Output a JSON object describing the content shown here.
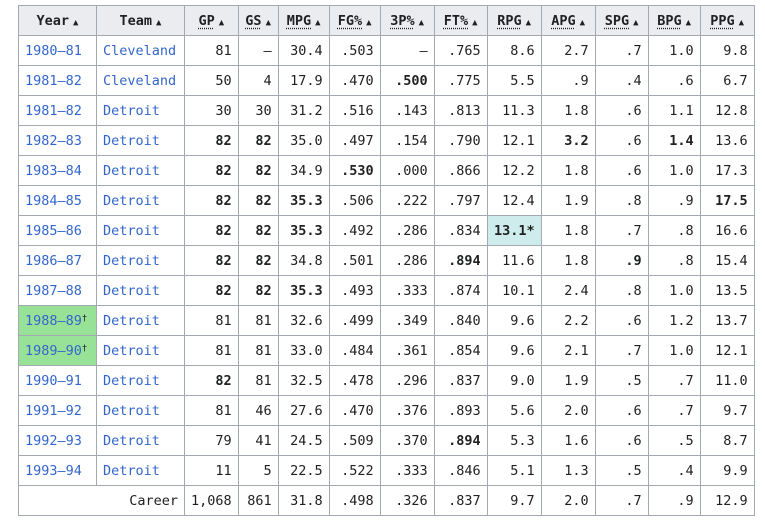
{
  "columns": [
    "Year",
    "Team",
    "GP",
    "GS",
    "MPG",
    "FG%",
    "3P%",
    "FT%",
    "RPG",
    "APG",
    "SPG",
    "BPG",
    "PPG"
  ],
  "rows": [
    {
      "year": "1980–81",
      "team": "Cleveland",
      "gp": "81",
      "gs": "–",
      "mpg": "30.4",
      "fg": ".503",
      "tp": "–",
      "ft": ".765",
      "rpg": "8.6",
      "apg": "2.7",
      "spg": ".7",
      "bpg": "1.0",
      "ppg": "9.8"
    },
    {
      "year": "1981–82",
      "team": "Cleveland",
      "gp": "50",
      "gs": "4",
      "mpg": "17.9",
      "fg": ".470",
      "tp": ".500",
      "ft": ".775",
      "rpg": "5.5",
      "apg": ".9",
      "spg": ".4",
      "bpg": ".6",
      "ppg": "6.7"
    },
    {
      "year": "1981–82",
      "team": "Detroit",
      "gp": "30",
      "gs": "30",
      "mpg": "31.2",
      "fg": ".516",
      "tp": ".143",
      "ft": ".813",
      "rpg": "11.3",
      "apg": "1.8",
      "spg": ".6",
      "bpg": "1.1",
      "ppg": "12.8"
    },
    {
      "year": "1982–83",
      "team": "Detroit",
      "gp": "82",
      "gs": "82",
      "mpg": "35.0",
      "fg": ".497",
      "tp": ".154",
      "ft": ".790",
      "rpg": "12.1",
      "apg": "3.2",
      "spg": ".6",
      "bpg": "1.4",
      "ppg": "13.6"
    },
    {
      "year": "1983–84",
      "team": "Detroit",
      "gp": "82",
      "gs": "82",
      "mpg": "34.9",
      "fg": ".530",
      "tp": ".000",
      "ft": ".866",
      "rpg": "12.2",
      "apg": "1.8",
      "spg": ".6",
      "bpg": "1.0",
      "ppg": "17.3"
    },
    {
      "year": "1984–85",
      "team": "Detroit",
      "gp": "82",
      "gs": "82",
      "mpg": "35.3",
      "fg": ".506",
      "tp": ".222",
      "ft": ".797",
      "rpg": "12.4",
      "apg": "1.9",
      "spg": ".8",
      "bpg": ".9",
      "ppg": "17.5"
    },
    {
      "year": "1985–86",
      "team": "Detroit",
      "gp": "82",
      "gs": "82",
      "mpg": "35.3",
      "fg": ".492",
      "tp": ".286",
      "ft": ".834",
      "rpg": "13.1*",
      "apg": "1.8",
      "spg": ".7",
      "bpg": ".8",
      "ppg": "16.6"
    },
    {
      "year": "1986–87",
      "team": "Detroit",
      "gp": "82",
      "gs": "82",
      "mpg": "34.8",
      "fg": ".501",
      "tp": ".286",
      "ft": ".894",
      "rpg": "11.6",
      "apg": "1.8",
      "spg": ".9",
      "bpg": ".8",
      "ppg": "15.4"
    },
    {
      "year": "1987–88",
      "team": "Detroit",
      "gp": "82",
      "gs": "82",
      "mpg": "35.3",
      "fg": ".493",
      "tp": ".333",
      "ft": ".874",
      "rpg": "10.1",
      "apg": "2.4",
      "spg": ".8",
      "bpg": "1.0",
      "ppg": "13.5"
    },
    {
      "year": "1988–89",
      "year_mark": "†",
      "team": "Detroit",
      "gp": "81",
      "gs": "81",
      "mpg": "32.6",
      "fg": ".499",
      "tp": ".349",
      "ft": ".840",
      "rpg": "9.6",
      "apg": "2.2",
      "spg": ".6",
      "bpg": "1.2",
      "ppg": "13.7"
    },
    {
      "year": "1989–90",
      "year_mark": "†",
      "team": "Detroit",
      "gp": "81",
      "gs": "81",
      "mpg": "33.0",
      "fg": ".484",
      "tp": ".361",
      "ft": ".854",
      "rpg": "9.6",
      "apg": "2.1",
      "spg": ".7",
      "bpg": "1.0",
      "ppg": "12.1"
    },
    {
      "year": "1990–91",
      "team": "Detroit",
      "gp": "82",
      "gs": "81",
      "mpg": "32.5",
      "fg": ".478",
      "tp": ".296",
      "ft": ".837",
      "rpg": "9.0",
      "apg": "1.9",
      "spg": ".5",
      "bpg": ".7",
      "ppg": "11.0"
    },
    {
      "year": "1991–92",
      "team": "Detroit",
      "gp": "81",
      "gs": "46",
      "mpg": "27.6",
      "fg": ".470",
      "tp": ".376",
      "ft": ".893",
      "rpg": "5.6",
      "apg": "2.0",
      "spg": ".6",
      "bpg": ".7",
      "ppg": "9.7"
    },
    {
      "year": "1992–93",
      "team": "Detroit",
      "gp": "79",
      "gs": "41",
      "mpg": "24.5",
      "fg": ".509",
      "tp": ".370",
      "ft": ".894",
      "rpg": "5.3",
      "apg": "1.6",
      "spg": ".6",
      "bpg": ".5",
      "ppg": "8.7"
    },
    {
      "year": "1993–94",
      "team": "Detroit",
      "gp": "11",
      "gs": "5",
      "mpg": "22.5",
      "fg": ".522",
      "tp": ".333",
      "ft": ".846",
      "rpg": "5.1",
      "apg": "1.3",
      "spg": ".5",
      "bpg": ".4",
      "ppg": "9.9"
    }
  ],
  "career": {
    "label": "Career",
    "gp": "1,068",
    "gs": "861",
    "mpg": "31.8",
    "fg": ".498",
    "tp": ".326",
    "ft": ".837",
    "rpg": "9.7",
    "apg": "2.0",
    "spg": ".7",
    "bpg": ".9",
    "ppg": "12.9"
  },
  "colors": {
    "link": "#3366cc",
    "header_bg": "#eaecf0",
    "border": "#a2a9b1",
    "champion_bg": "#98e298",
    "league_leader_bg": "#cfecec"
  }
}
